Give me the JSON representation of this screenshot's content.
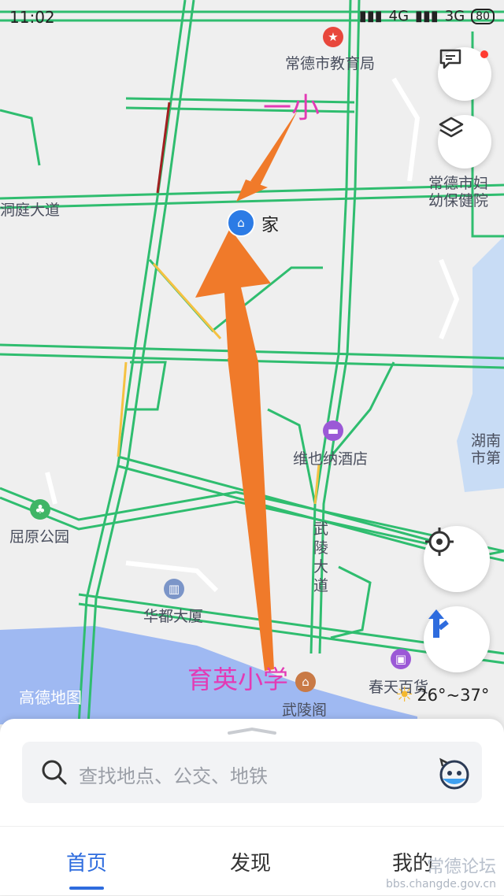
{
  "status_bar": {
    "time": "11:02",
    "network_1": "4G",
    "network_2": "3G",
    "battery": "80"
  },
  "map_labels": {
    "edu_bureau": "常德市教育局",
    "hospital_line1": "常德市妇",
    "hospital_line2": "幼保健院",
    "road_dongting": "洞庭大道",
    "home": "家",
    "hotel": "维也纳酒店",
    "hunan_line1": "湖南",
    "hunan_line2": "市第",
    "quyuan_park": "屈原公园",
    "wuling_road_1": "武",
    "wuling_road_2": "陵",
    "wuling_road_3": "大",
    "wuling_road_4": "道",
    "huadu": "华都大厦",
    "wulingge": "武陵阁",
    "chuntian": "春天百货",
    "logo": "高德地图"
  },
  "annotations": {
    "top": "一小",
    "bottom": "育英小学"
  },
  "weather": {
    "temp": "26°~37°"
  },
  "search": {
    "placeholder": "查找地点、公交、地铁"
  },
  "tabs": [
    {
      "label": "首页"
    },
    {
      "label": "发现"
    },
    {
      "label": "我的"
    }
  ],
  "watermark": {
    "line1": "常德论坛",
    "line2": "bbs.changde.gov.cn"
  },
  "colors": {
    "road": "#2fbd6f",
    "accent": "#2e6cde",
    "arrow": "#f07a2a",
    "annotation": "#e33ab5"
  }
}
